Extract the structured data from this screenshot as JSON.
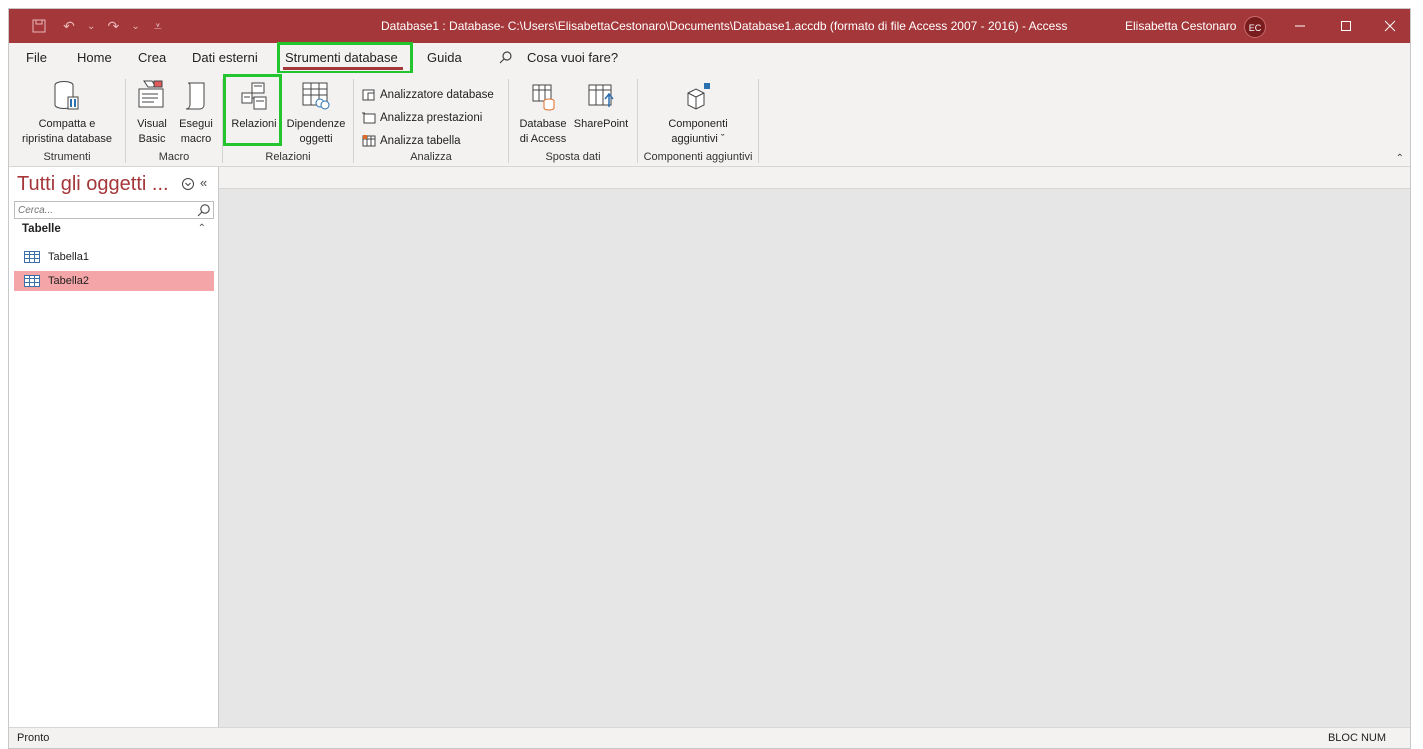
{
  "titlebar": {
    "title": "Database1 : Database- C:\\Users\\ElisabettaCestonaro\\Documents\\Database1.accdb (formato di file Access 2007 - 2016)  -  Access",
    "user_name": "Elisabetta Cestonaro",
    "user_initials": "EC",
    "colors": {
      "brand": "#a4373a",
      "highlight_box": "#22c52e"
    }
  },
  "tabs": {
    "file": "File",
    "home": "Home",
    "crea": "Crea",
    "dati_esterni": "Dati esterni",
    "strumenti_database": "Strumenti database",
    "guida": "Guida",
    "tell_me": "Cosa vuoi fare?"
  },
  "ribbon": {
    "strumenti": {
      "label": "Strumenti",
      "compatta": "Compatta e\nripristina database"
    },
    "macro": {
      "label": "Macro",
      "visual_basic": "Visual\nBasic",
      "esegui_macro": "Esegui\nmacro"
    },
    "relazioni": {
      "label": "Relazioni",
      "relazioni": "Relazioni",
      "dipendenze": "Dipendenze\noggetti"
    },
    "analizza": {
      "label": "Analizza",
      "analizzatore": "Analizzatore database",
      "prestazioni": "Analizza prestazioni",
      "tabella": "Analizza tabella"
    },
    "sposta_dati": {
      "label": "Sposta dati",
      "database_access": "Database\ndi Access",
      "sharepoint": "SharePoint"
    },
    "componenti": {
      "label": "Componenti aggiuntivi",
      "componenti": "Componenti\naggiuntivi ˇ"
    }
  },
  "nav": {
    "title": "Tutti gli oggetti ...",
    "search_placeholder": "Cerca...",
    "section": "Tabelle",
    "items": [
      {
        "label": "Tabella1",
        "selected": false
      },
      {
        "label": "Tabella2",
        "selected": true
      }
    ]
  },
  "status": {
    "left": "Pronto",
    "right": "BLOC NUM"
  }
}
